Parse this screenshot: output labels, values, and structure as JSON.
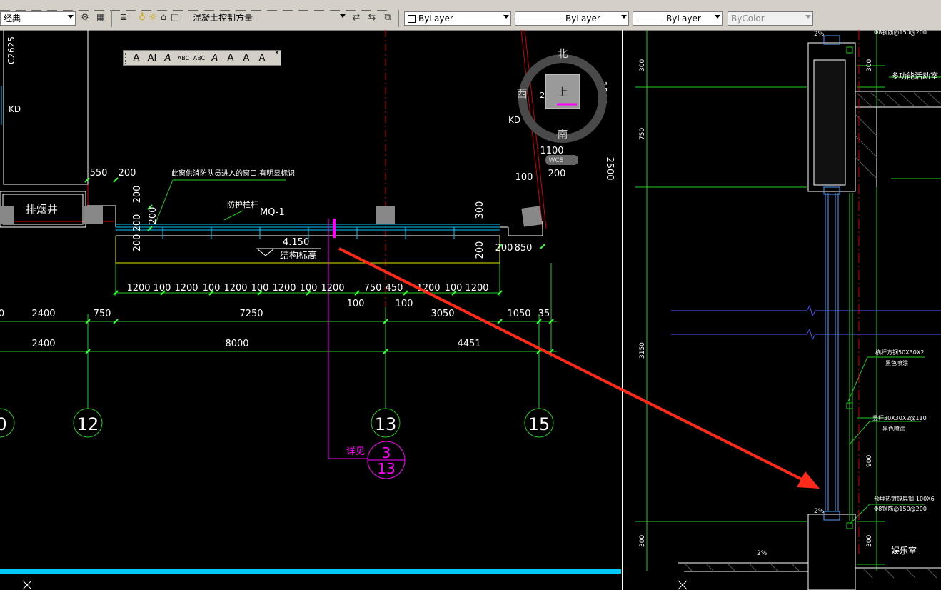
{
  "toolbar": {
    "workspace": "经典",
    "layer": "混凝土控制方量",
    "color": "ByLayer",
    "linetype": "ByLayer",
    "lineweight": "ByLayer",
    "plotstyle": "ByColor"
  },
  "text_toolbar": {
    "buttons": [
      "A",
      "AI",
      "A",
      "ABC",
      "ABC",
      "A",
      "A",
      "A",
      "A"
    ]
  },
  "compass": {
    "north": "北",
    "south": "南",
    "west": "西",
    "top": "上",
    "ucs": "WCS"
  },
  "plan": {
    "smoke_shaft": "排烟井",
    "window_note": "此窗供消防队员进入的窗口,有明显标识",
    "railing": "防护栏杆",
    "curtain_wall": "MQ-1",
    "elevation_value": "4.150",
    "elevation_label": "结构标高",
    "kd_left": "KD",
    "kd_right": "KD",
    "c2625": "C2625",
    "pct_compass": "2%",
    "detail_ref_label": "详见",
    "detail_ref_top": "3",
    "detail_ref_bottom": "13",
    "axes": [
      "0",
      "12",
      "13",
      "15"
    ],
    "dims_top": [
      "550",
      "200"
    ],
    "dims_v_left": [
      "200",
      "200",
      "100",
      "200"
    ],
    "dims_v_left2": "200",
    "dims_right": [
      "300",
      "200",
      "200",
      "850"
    ],
    "dims_right_upper": [
      "1100",
      "100",
      "200",
      "2500",
      "1500"
    ],
    "dims_row1": [
      "1200",
      "100",
      "1200",
      "100",
      "1200",
      "100",
      "1200",
      "100",
      "1200",
      "750",
      "450",
      "1200",
      "100",
      "1200"
    ],
    "dims_row1_sub": [
      "100",
      "100"
    ],
    "dims_row2": [
      "0",
      "2400",
      "750",
      "7250",
      "3050",
      "1050",
      "35"
    ],
    "dims_row3": [
      "2400",
      "8000",
      "4451"
    ]
  },
  "section": {
    "pct_top": "2%",
    "pct_mid": "2%",
    "pct_bottom": "2%",
    "room_top": "多功能活动室",
    "room_bottom": "娱乐室",
    "dims_left": [
      "300",
      "750",
      "3150",
      "300"
    ],
    "dims_right": [
      "300",
      "900",
      "300"
    ],
    "note1a": "横杆方钢50X30X2",
    "note1b": "黑色喷涂",
    "note2a": "竖杆30X30X2@110",
    "note2b": "黑色喷涂",
    "note3a": "预埋热镀锌扁钢-100X6",
    "note3b": "Φ8钢筋@150@200",
    "note_top": "Φ8钢筋@150@200"
  },
  "colors": {
    "dim_green": "#33ff33",
    "axis_red": "#ff0000",
    "magenta": "#ff00ff",
    "cyan": "#00e5ff",
    "yellow": "#ffff00",
    "background": "#000000"
  }
}
